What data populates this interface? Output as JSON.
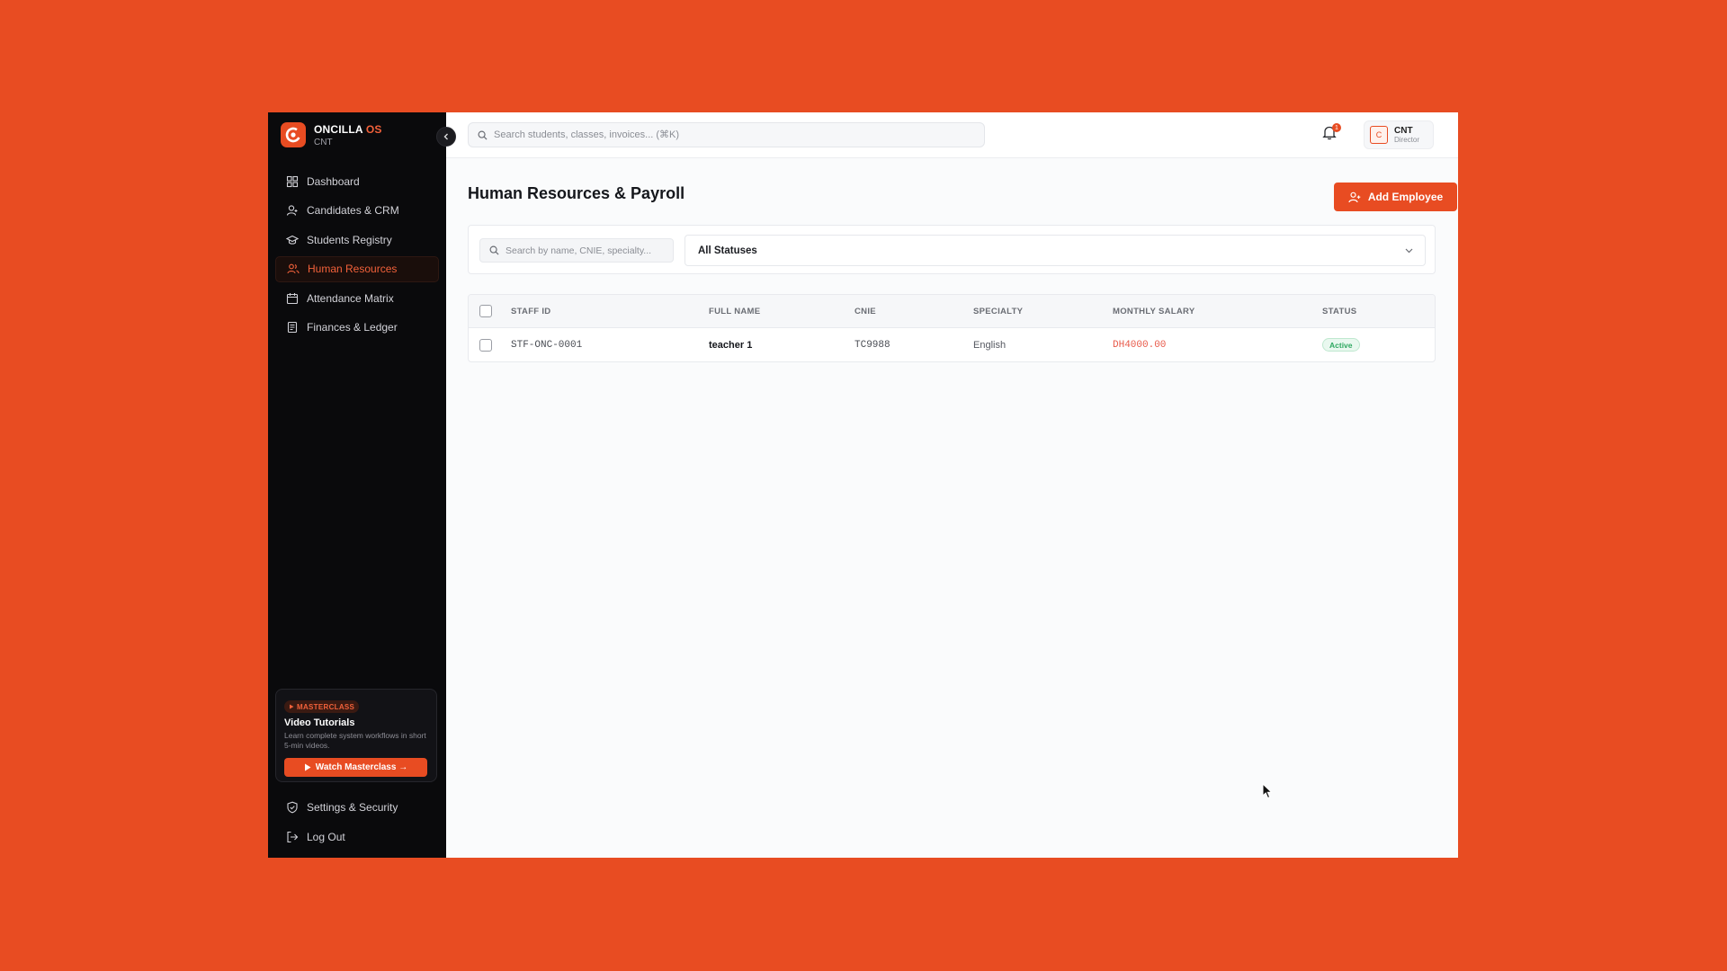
{
  "brand": {
    "name": "ONCILLA",
    "name_accent": "OS",
    "workspace": "CNT"
  },
  "sidebar": {
    "items": [
      {
        "label": "Dashboard",
        "icon": "grid-icon",
        "active": false
      },
      {
        "label": "Candidates & CRM",
        "icon": "user-plus-icon",
        "active": false
      },
      {
        "label": "Students Registry",
        "icon": "graduation-cap-icon",
        "active": false
      },
      {
        "label": "Human Resources",
        "icon": "users-icon",
        "active": true
      },
      {
        "label": "Attendance Matrix",
        "icon": "calendar-icon",
        "active": false
      },
      {
        "label": "Finances & Ledger",
        "icon": "ledger-icon",
        "active": false
      }
    ],
    "bottom_items": [
      {
        "label": "Settings & Security",
        "icon": "shield-icon"
      },
      {
        "label": "Log Out",
        "icon": "logout-icon"
      }
    ],
    "promo": {
      "badge": "MASTERCLASS",
      "title": "Video Tutorials",
      "description": "Learn complete system workflows in short 5-min videos.",
      "button": "Watch Masterclass →"
    }
  },
  "topbar": {
    "search_placeholder": "Search students, classes, invoices... (⌘K)",
    "notification_count": "1",
    "user": {
      "initial": "C",
      "name": "CNT",
      "role": "Director"
    }
  },
  "page": {
    "title": "Human Resources & Payroll",
    "add_button": "Add Employee"
  },
  "filters": {
    "search_placeholder": "Search by name, CNIE, specialty...",
    "status_selected": "All Statuses"
  },
  "table": {
    "columns": [
      "STAFF ID",
      "FULL NAME",
      "CNIE",
      "SPECIALTY",
      "MONTHLY SALARY",
      "STATUS"
    ],
    "rows": [
      {
        "staff_id": "STF-ONC-0001",
        "full_name": "teacher 1",
        "cnie": "TC9988",
        "specialty": "English",
        "salary": "DH4000.00",
        "status": "Active"
      }
    ]
  },
  "colors": {
    "accent": "#E84C22",
    "sidebar_bg": "#0A0A0C",
    "status_active": "#2FA861"
  }
}
